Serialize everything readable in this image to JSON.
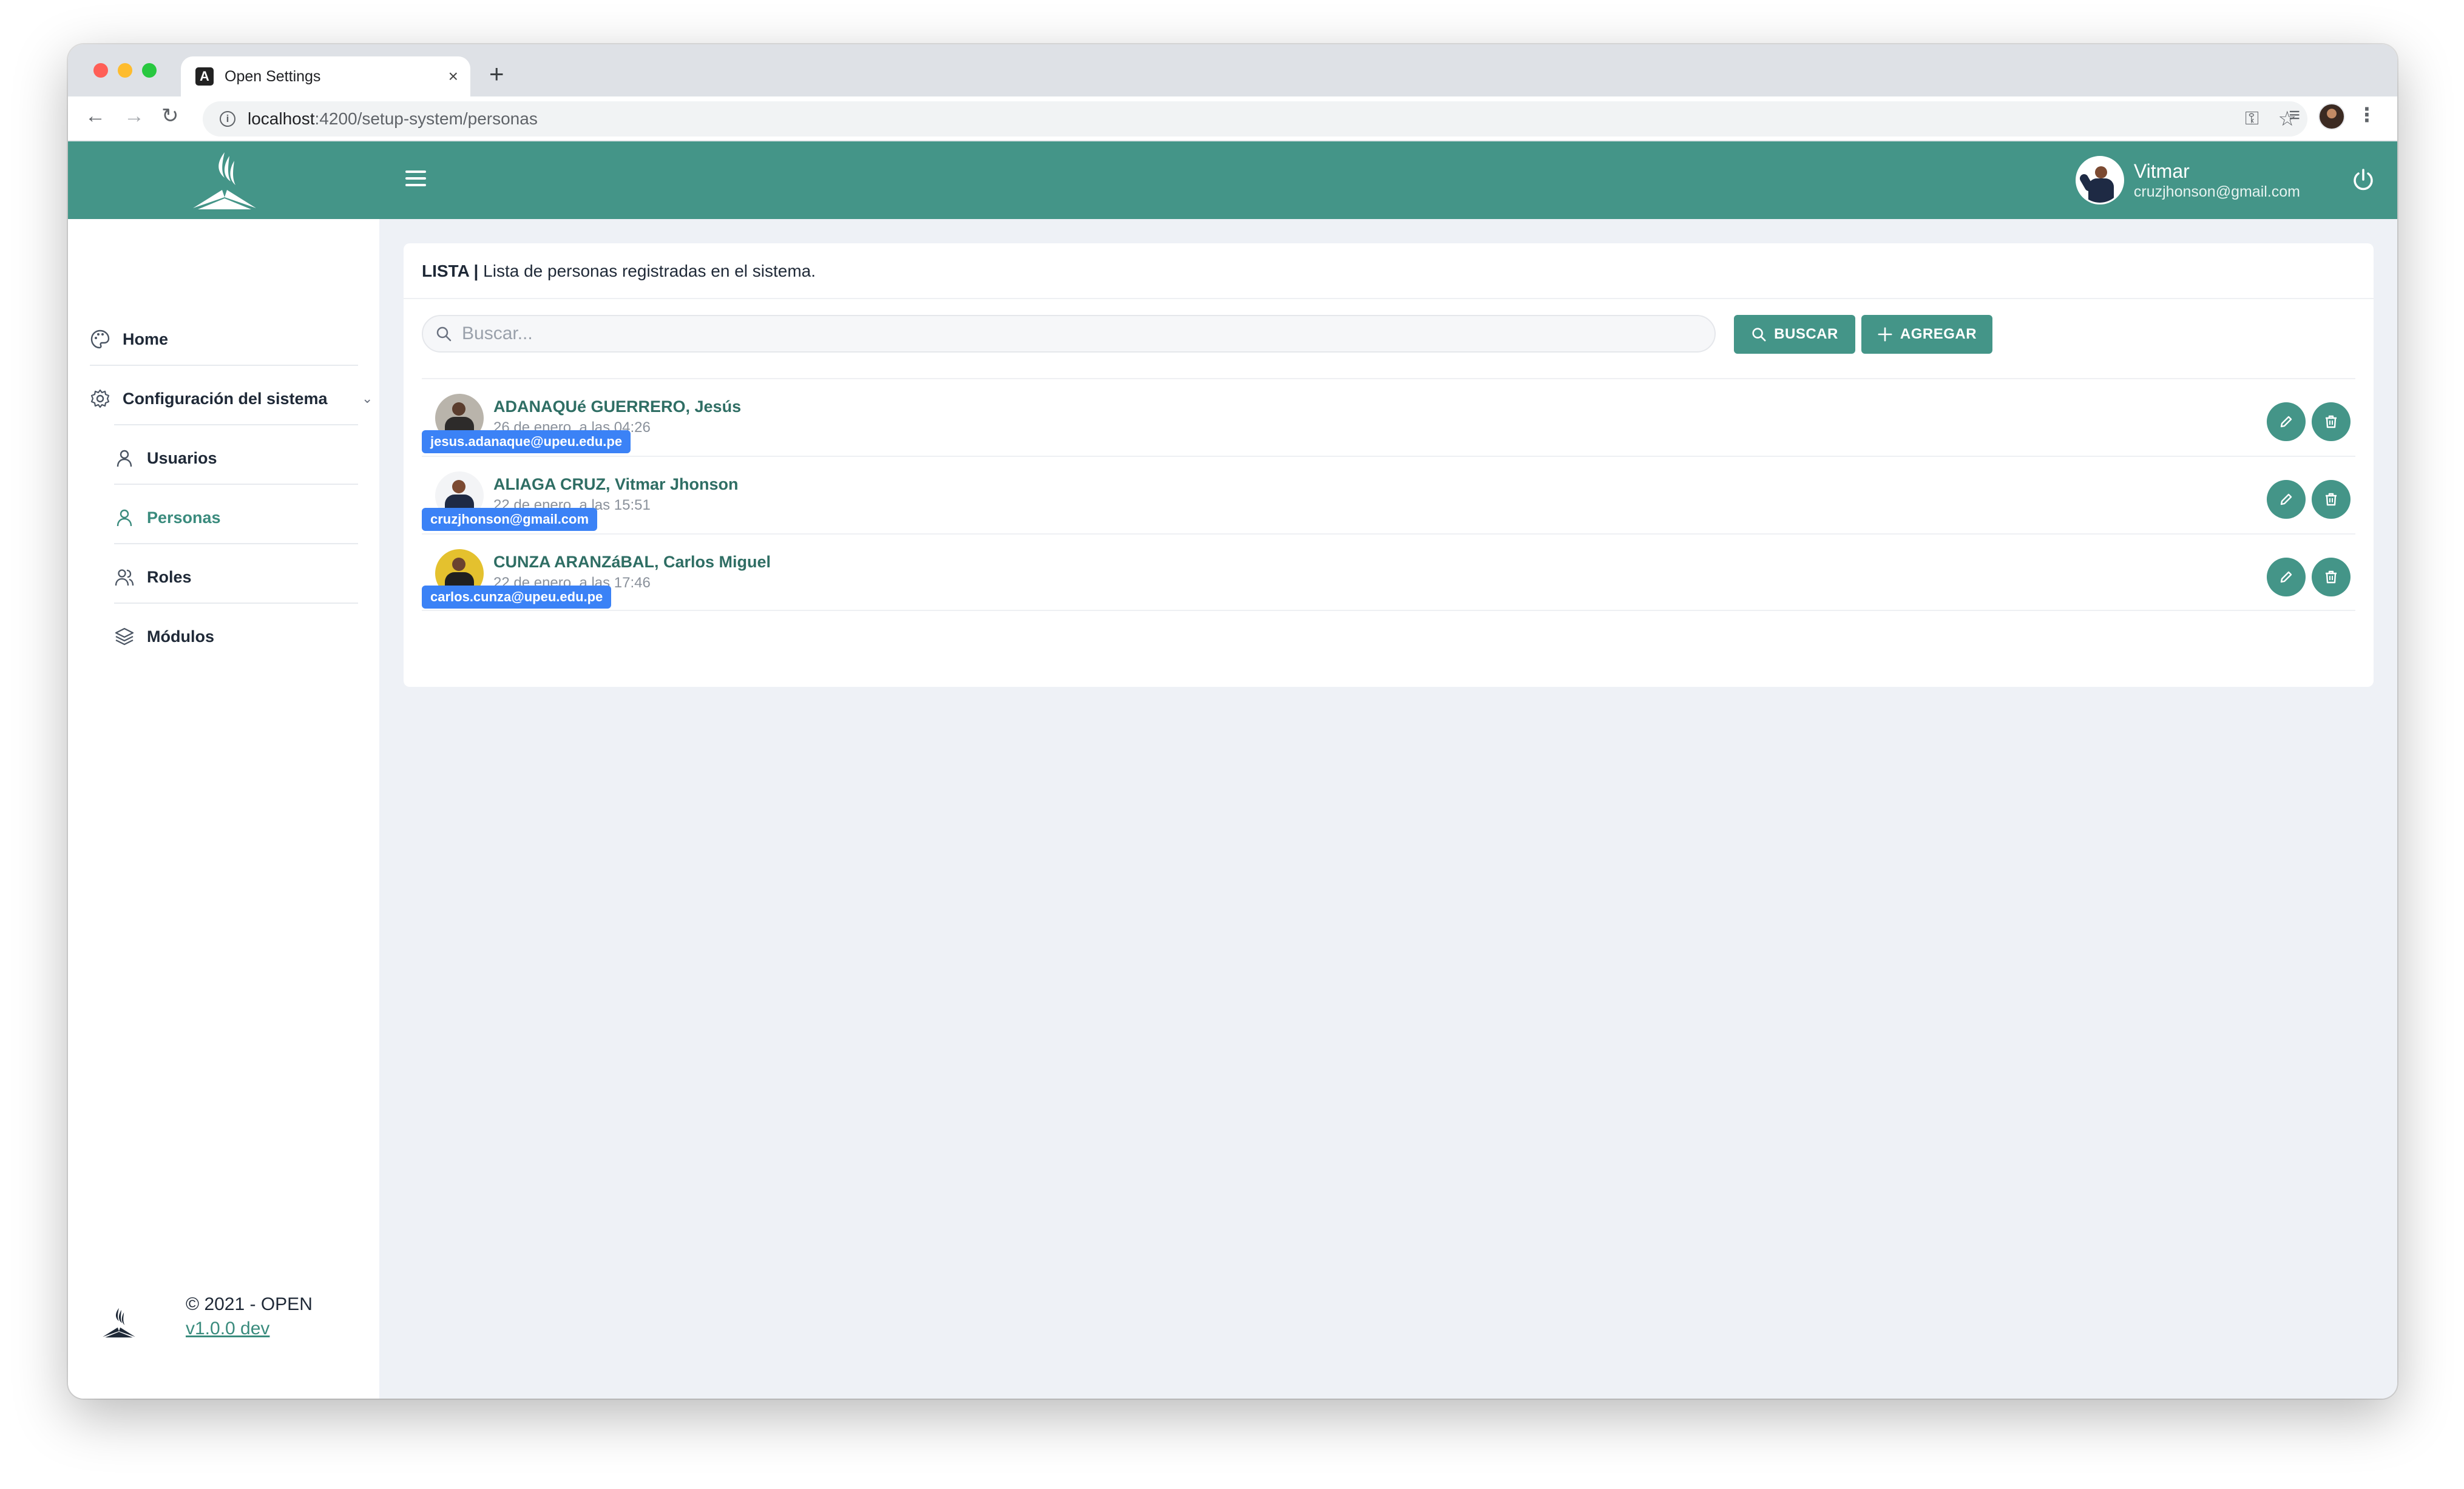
{
  "browser": {
    "tab_title": "Open Settings",
    "tab_close": "×",
    "new_tab": "+",
    "url_host": "localhost",
    "url_path": ":4200/setup-system/personas"
  },
  "topbar": {
    "user_name": "Vitmar",
    "user_email": "cruzjhonson@gmail.com"
  },
  "sidebar": {
    "items": [
      {
        "label": "Home",
        "icon": "palette-icon"
      },
      {
        "label": "Configuración del sistema",
        "icon": "gear-icon"
      },
      {
        "label": "Usuarios",
        "icon": "user-icon"
      },
      {
        "label": "Personas",
        "icon": "user-icon",
        "active": true
      },
      {
        "label": "Roles",
        "icon": "users-icon"
      },
      {
        "label": "Módulos",
        "icon": "layers-icon"
      }
    ],
    "footer_copy": "© 2021 - OPEN",
    "footer_version": "v1.0.0 dev"
  },
  "card": {
    "title_bold": "LISTA |",
    "title_text": "Lista de personas registradas en el sistema.",
    "search_placeholder": "Buscar...",
    "btn_search": "BUSCAR",
    "btn_add": "AGREGAR"
  },
  "people": [
    {
      "name": "ADANAQUé GUERRERO, Jesús",
      "date": "26 de enero, a las 04:26",
      "email": "jesus.adanaque@upeu.edu.pe"
    },
    {
      "name": "ALIAGA CRUZ, Vitmar Jhonson",
      "date": "22 de enero, a las 15:51",
      "email": "cruzjhonson@gmail.com"
    },
    {
      "name": "CUNZA ARANZáBAL, Carlos Miguel",
      "date": "22 de enero, a las 17:46",
      "email": "carlos.cunza@upeu.edu.pe"
    }
  ],
  "colors": {
    "primary": "#449588",
    "badge": "#3b82f6",
    "background": "#eef1f6"
  }
}
